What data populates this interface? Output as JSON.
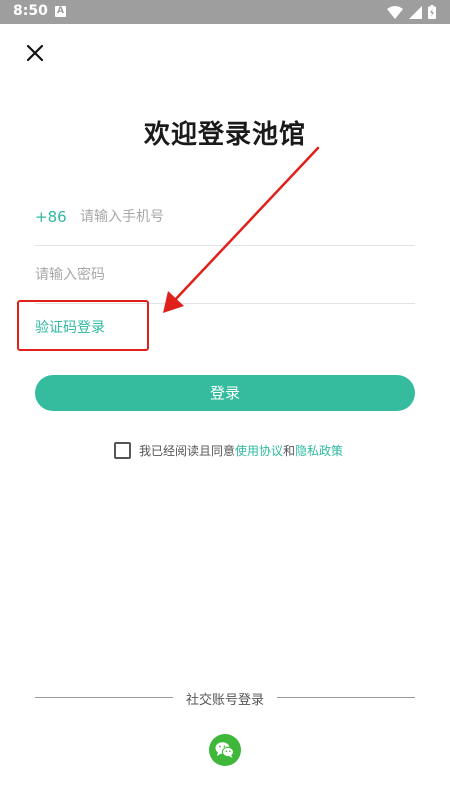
{
  "status_bar": {
    "time": "8:50",
    "notification_letter": "A",
    "icons": [
      "wifi-icon",
      "signal-icon",
      "battery-icon"
    ]
  },
  "header": {
    "close_icon": "close-icon"
  },
  "title": "欢迎登录池馆",
  "form": {
    "country_code": "+86",
    "phone_placeholder": "请输入手机号",
    "password_placeholder": "请输入密码",
    "code_login_label": "验证码登录",
    "login_button": "登录"
  },
  "agreement": {
    "prefix": "我已经阅读且同意",
    "terms_link": "使用协议",
    "conjunction": "和",
    "privacy_link": "隐私政策",
    "checked": false
  },
  "social": {
    "label": "社交账号登录",
    "items": [
      "wechat-icon"
    ]
  },
  "annotation": {
    "color": "#e0201b"
  },
  "colors": {
    "accent": "#2fb9a0",
    "button": "#35bc9e",
    "wechat": "#3fb73a"
  }
}
